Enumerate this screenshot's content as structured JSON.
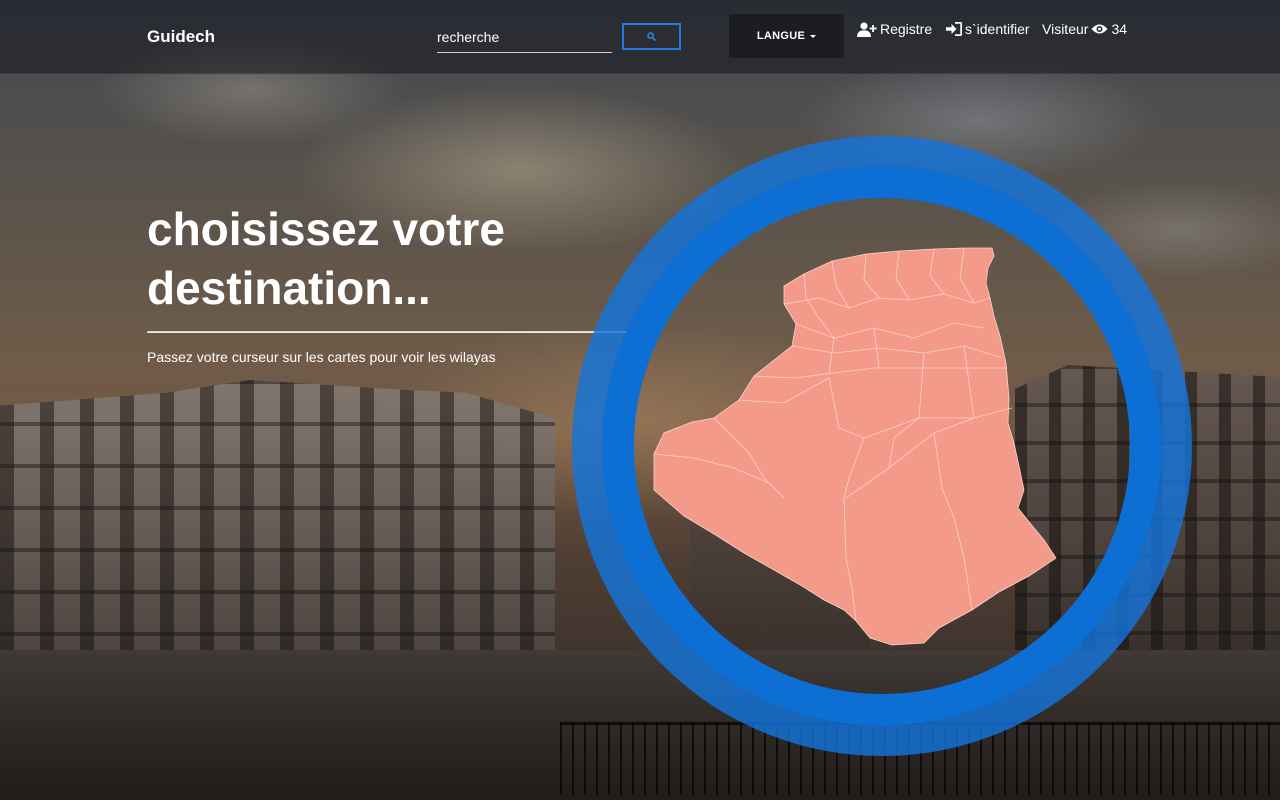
{
  "navbar": {
    "brand": "Guidech",
    "search_placeholder": "recherche",
    "language_label": "LANGUE",
    "register_label": "Registre",
    "login_label": "s`identifier",
    "visitor_label": "Visiteur",
    "visitor_count": "34"
  },
  "hero": {
    "title_line1": "choisissez votre",
    "title_line2": "destination...",
    "subtitle": "Passez votre curseur sur les cartes pour voir les wilayas"
  },
  "map": {
    "region_color": "#f39a8b",
    "ring_color": "#1374dc"
  },
  "icons": {
    "search": "search-icon",
    "register": "user-plus-icon",
    "login": "sign-in-icon",
    "visitor": "eye-icon"
  }
}
